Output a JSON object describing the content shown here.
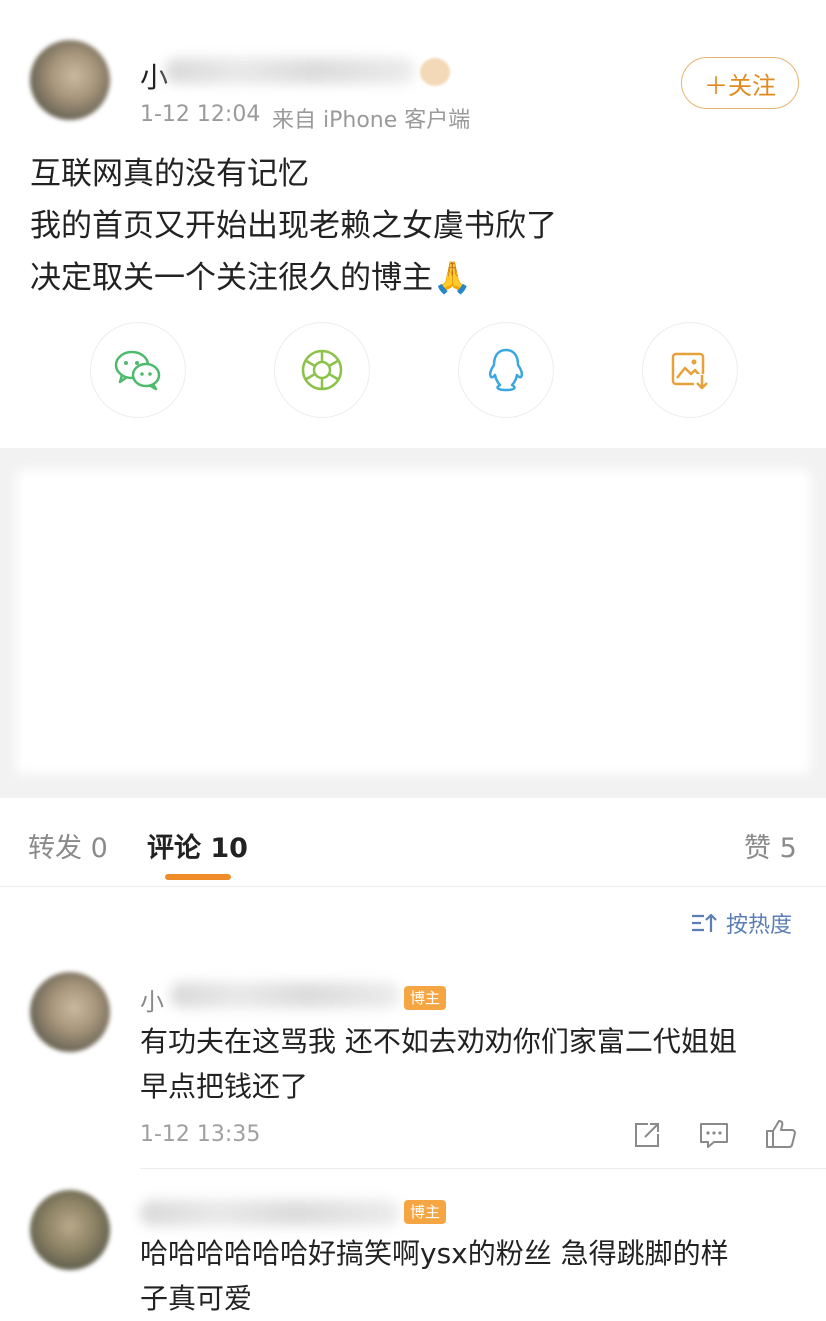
{
  "post": {
    "author_visible": "小",
    "time": "1-12 12:04",
    "source": "来自 iPhone 客户端",
    "follow_label": "＋关注",
    "lines": [
      "互联网真的没有记忆",
      "我的首页又开始出现老赖之女虞书欣了",
      "决定取关一个关注很久的博主🙏"
    ]
  },
  "share": {
    "icons": [
      "wechat-icon",
      "moments-icon",
      "qq-icon",
      "save-image-icon"
    ]
  },
  "tabs": {
    "repost": "转发 0",
    "comments": "评论 10",
    "likes": "赞 5"
  },
  "sort_label": "按热度",
  "comments": [
    {
      "name_visible": "小",
      "badge": "博主",
      "line1": "有功夫在这骂我 还不如去劝劝你们家富二代姐姐",
      "line2": "早点把钱还了",
      "time": "1-12 13:35"
    },
    {
      "name_visible": "",
      "badge": "博主",
      "line1": "哈哈哈哈哈哈好搞笑啊ysx的粉丝 急得跳脚的样",
      "line2": "子真可爱"
    }
  ],
  "colors": {
    "accent": "#e08a1e",
    "badge": "#f5a541",
    "wechat": "#4fb96c",
    "moments": "#8bc34a",
    "qq": "#3aa7e0",
    "save": "#e8a13a"
  }
}
